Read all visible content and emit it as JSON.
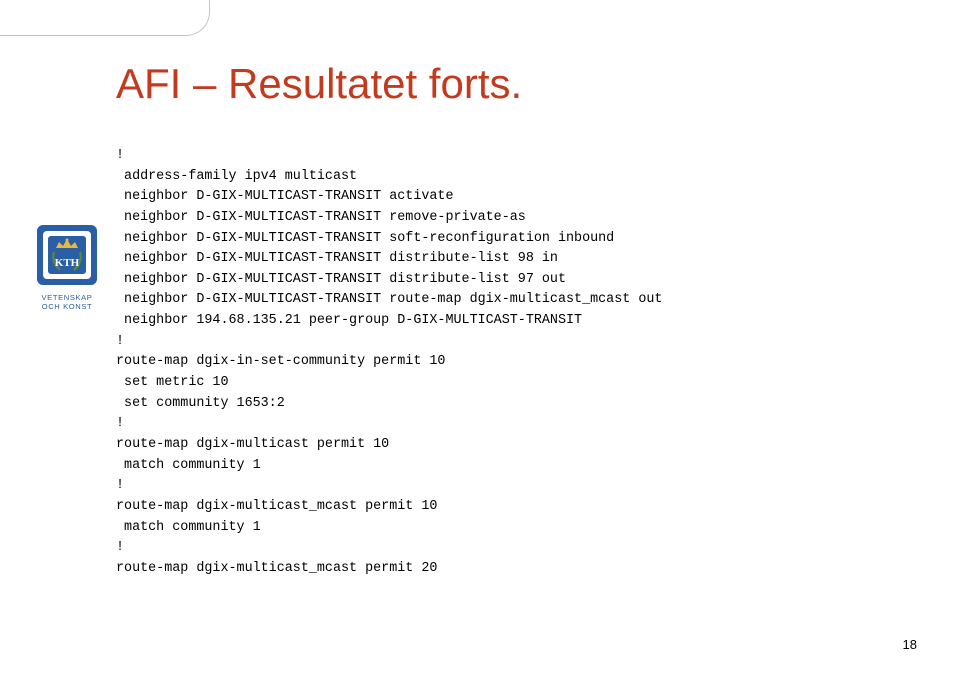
{
  "title": "AFI – Resultatet forts.",
  "logo": {
    "upper": "VETENSKAP",
    "lower": "OCH KONST",
    "name": "KTH"
  },
  "code_lines": [
    "!",
    " address-family ipv4 multicast",
    " neighbor D-GIX-MULTICAST-TRANSIT activate",
    " neighbor D-GIX-MULTICAST-TRANSIT remove-private-as",
    " neighbor D-GIX-MULTICAST-TRANSIT soft-reconfiguration inbound",
    " neighbor D-GIX-MULTICAST-TRANSIT distribute-list 98 in",
    " neighbor D-GIX-MULTICAST-TRANSIT distribute-list 97 out",
    " neighbor D-GIX-MULTICAST-TRANSIT route-map dgix-multicast_mcast out",
    " neighbor 194.68.135.21 peer-group D-GIX-MULTICAST-TRANSIT",
    "!",
    "route-map dgix-in-set-community permit 10",
    " set metric 10",
    " set community 1653:2",
    "!",
    "route-map dgix-multicast permit 10",
    " match community 1",
    "!",
    "route-map dgix-multicast_mcast permit 10",
    " match community 1",
    "!",
    "route-map dgix-multicast_mcast permit 20"
  ],
  "page_number": "18"
}
